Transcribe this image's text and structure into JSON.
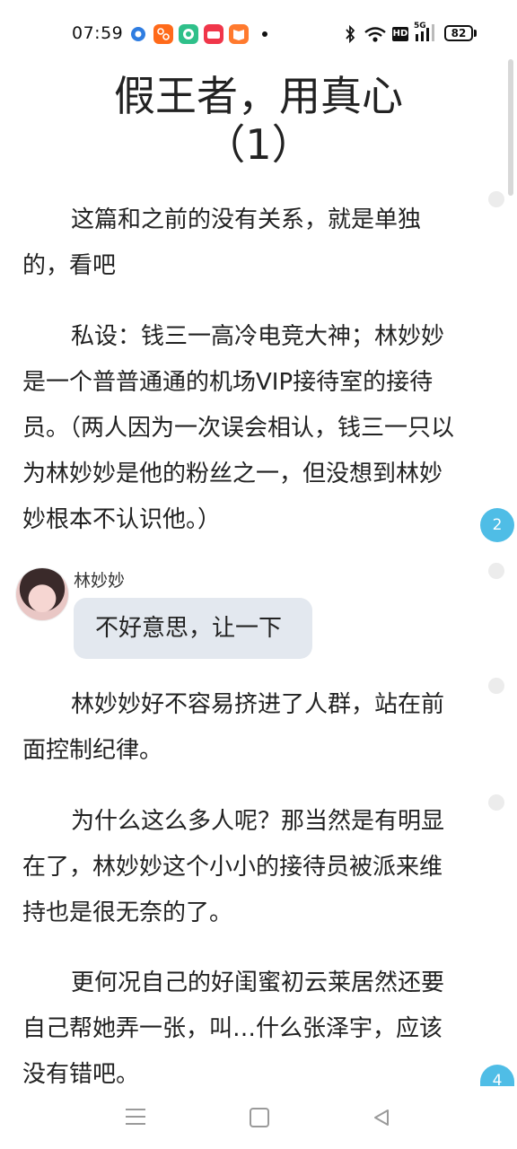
{
  "status_bar": {
    "time": "07:59",
    "network": "5G",
    "hd": "HD",
    "battery": "82",
    "notification_icons": [
      "browser-icon",
      "taobao-icon",
      "green-app-icon",
      "red-shopping-icon",
      "orange-reader-icon"
    ]
  },
  "article": {
    "title_line1": "假王者，用真心",
    "title_line2": "（1）",
    "p1": "这篇和之前的没有关系，就是单独的，看吧",
    "p2": "私设：钱三一高冷电竞大神；林妙妙是一个普普通通的机场VIP接待室的接待员。（两人因为一次误会相认，钱三一只以为林妙妙是他的粉丝之一，但没想到林妙妙根本不认识他。）",
    "chat": {
      "name": "林妙妙",
      "message": "不好意思，让一下"
    },
    "p3": "林妙妙好不容易挤进了人群，站在前面控制纪律。",
    "p4": "为什么这么多人呢？那当然是有明显在了，林妙妙这个小小的接待员被派来维持也是很无奈的了。",
    "p5": "更何况自己的好闺蜜初云莱居然还要自己帮她弄一张，叫…什么张泽宇，应该没有错吧。"
  },
  "comments": {
    "badge_a": "2",
    "badge_b": "4"
  },
  "colors": {
    "badge": "#4fbde6",
    "bubble": "#e3e8ef",
    "text": "#222222"
  },
  "nav": {
    "icons": [
      "menu-icon",
      "home-icon",
      "back-icon"
    ]
  }
}
